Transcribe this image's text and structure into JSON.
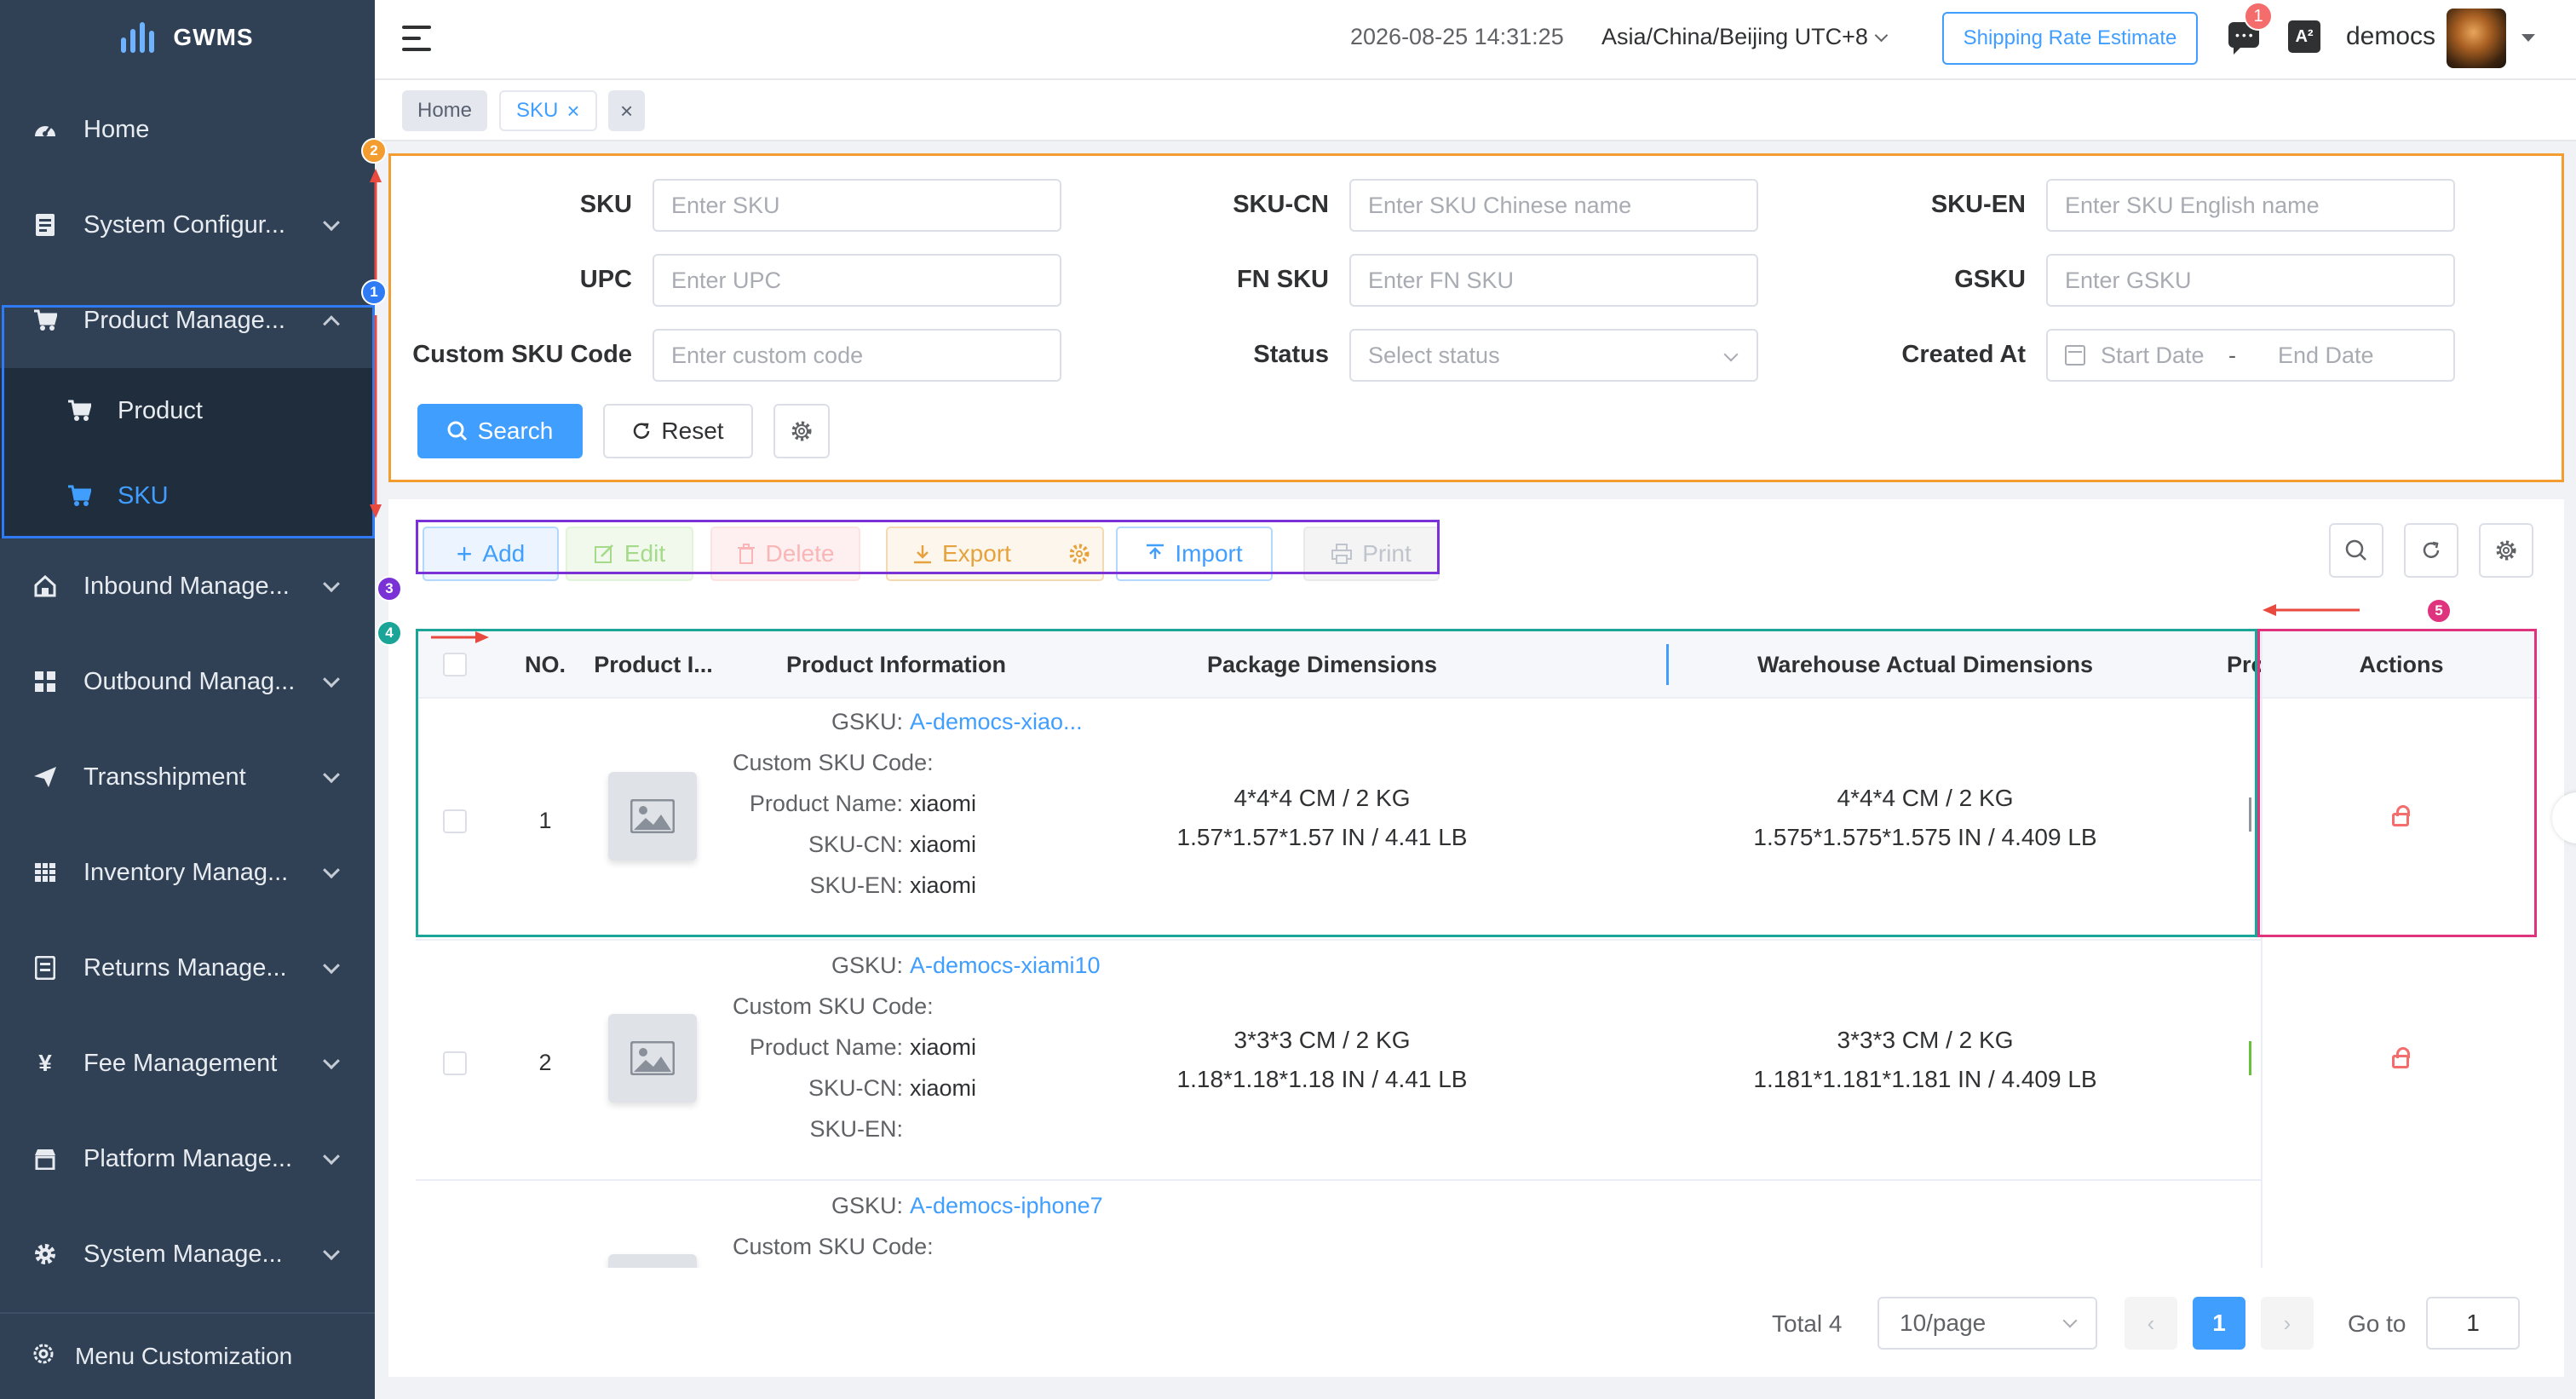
{
  "app": {
    "name": "GWMS"
  },
  "sidebar": {
    "items": [
      {
        "label": "Home",
        "icon": "dashboard-icon"
      },
      {
        "label": "System Configur...",
        "icon": "document-icon"
      },
      {
        "label": "Product Manage...",
        "icon": "cart-icon",
        "expanded": true
      },
      {
        "label": "Inbound Manage...",
        "icon": "home-icon"
      },
      {
        "label": "Outbound Manag...",
        "icon": "grid-icon"
      },
      {
        "label": "Transshipment",
        "icon": "send-icon"
      },
      {
        "label": "Inventory Manag...",
        "icon": "table-icon"
      },
      {
        "label": "Returns Manage...",
        "icon": "return-icon"
      },
      {
        "label": "Fee Management",
        "icon": "yen-icon"
      },
      {
        "label": "Platform Manage...",
        "icon": "store-icon"
      },
      {
        "label": "System Manage...",
        "icon": "gear-icon"
      }
    ],
    "subitems": [
      {
        "label": "Product",
        "icon": "cart-icon"
      },
      {
        "label": "SKU",
        "icon": "cart-icon",
        "active": true
      }
    ],
    "footer": "Menu Customization"
  },
  "header": {
    "datetime": "2026-08-25 14:31:25",
    "timezone": "Asia/China/Beijing UTC+8",
    "shipping_btn": "Shipping Rate Estimate",
    "msg_badge": "1",
    "lang_icon": "A²",
    "username": "democs"
  },
  "tags": [
    {
      "label": "Home"
    },
    {
      "label": "SKU",
      "close": "×"
    },
    {
      "label": "×"
    }
  ],
  "search": {
    "fields": [
      {
        "label": "SKU",
        "placeholder": "Enter SKU"
      },
      {
        "label": "SKU-CN",
        "placeholder": "Enter SKU Chinese name"
      },
      {
        "label": "SKU-EN",
        "placeholder": "Enter SKU English name"
      },
      {
        "label": "UPC",
        "placeholder": "Enter UPC"
      },
      {
        "label": "FN SKU",
        "placeholder": "Enter FN SKU"
      },
      {
        "label": "GSKU",
        "placeholder": "Enter GSKU"
      },
      {
        "label": "Custom SKU Code",
        "placeholder": "Enter custom code"
      },
      {
        "label": "Status",
        "placeholder": "Select status"
      },
      {
        "label": "Created At",
        "start": "Start Date",
        "sep": "-",
        "end": "End Date"
      }
    ],
    "search_btn": "Search",
    "reset_btn": "Reset"
  },
  "toolbar": {
    "add": "Add",
    "edit": "Edit",
    "delete": "Delete",
    "export": "Export",
    "import": "Import",
    "print": "Print"
  },
  "table": {
    "columns": [
      "NO.",
      "Product I...",
      "Product Information",
      "Package Dimensions",
      "Warehouse Actual Dimensions",
      "Pro",
      "Actions"
    ],
    "info_keys": {
      "gsku": "GSKU:",
      "custom": "Custom SKU Code:",
      "name": "Product Name:",
      "cn": "SKU-CN:",
      "en": "SKU-EN:"
    },
    "rows": [
      {
        "no": "1",
        "gsku": "A-democs-xiao...",
        "custom": "",
        "name": "xiaomi",
        "cn": "xiaomi",
        "en": "xiaomi",
        "pkg1": "4*4*4 CM / 2 KG",
        "pkg2": "1.57*1.57*1.57 IN / 4.41 LB",
        "wh1": "4*4*4 CM / 2 KG",
        "wh2": "1.575*1.575*1.575 IN / 4.409 LB"
      },
      {
        "no": "2",
        "gsku": "A-democs-xiami10",
        "custom": "",
        "name": "xiaomi",
        "cn": "xiaomi",
        "en": "",
        "pkg1": "3*3*3 CM / 2 KG",
        "pkg2": "1.18*1.18*1.18 IN / 4.41 LB",
        "wh1": "3*3*3 CM / 2 KG",
        "wh2": "1.181*1.181*1.181 IN / 4.409 LB"
      },
      {
        "no": "",
        "gsku": "A-democs-iphone7",
        "custom": "",
        "name": "",
        "cn": "",
        "en": ""
      }
    ]
  },
  "pagination": {
    "total": "Total 4",
    "page_size": "10/page",
    "current": "1",
    "goto_label": "Go to",
    "goto_value": "1"
  },
  "annotations": [
    "1",
    "2",
    "3",
    "4",
    "5"
  ],
  "colors": {
    "sidebar_bg": "#304156",
    "primary": "#409eff",
    "danger": "#f56c6c"
  }
}
